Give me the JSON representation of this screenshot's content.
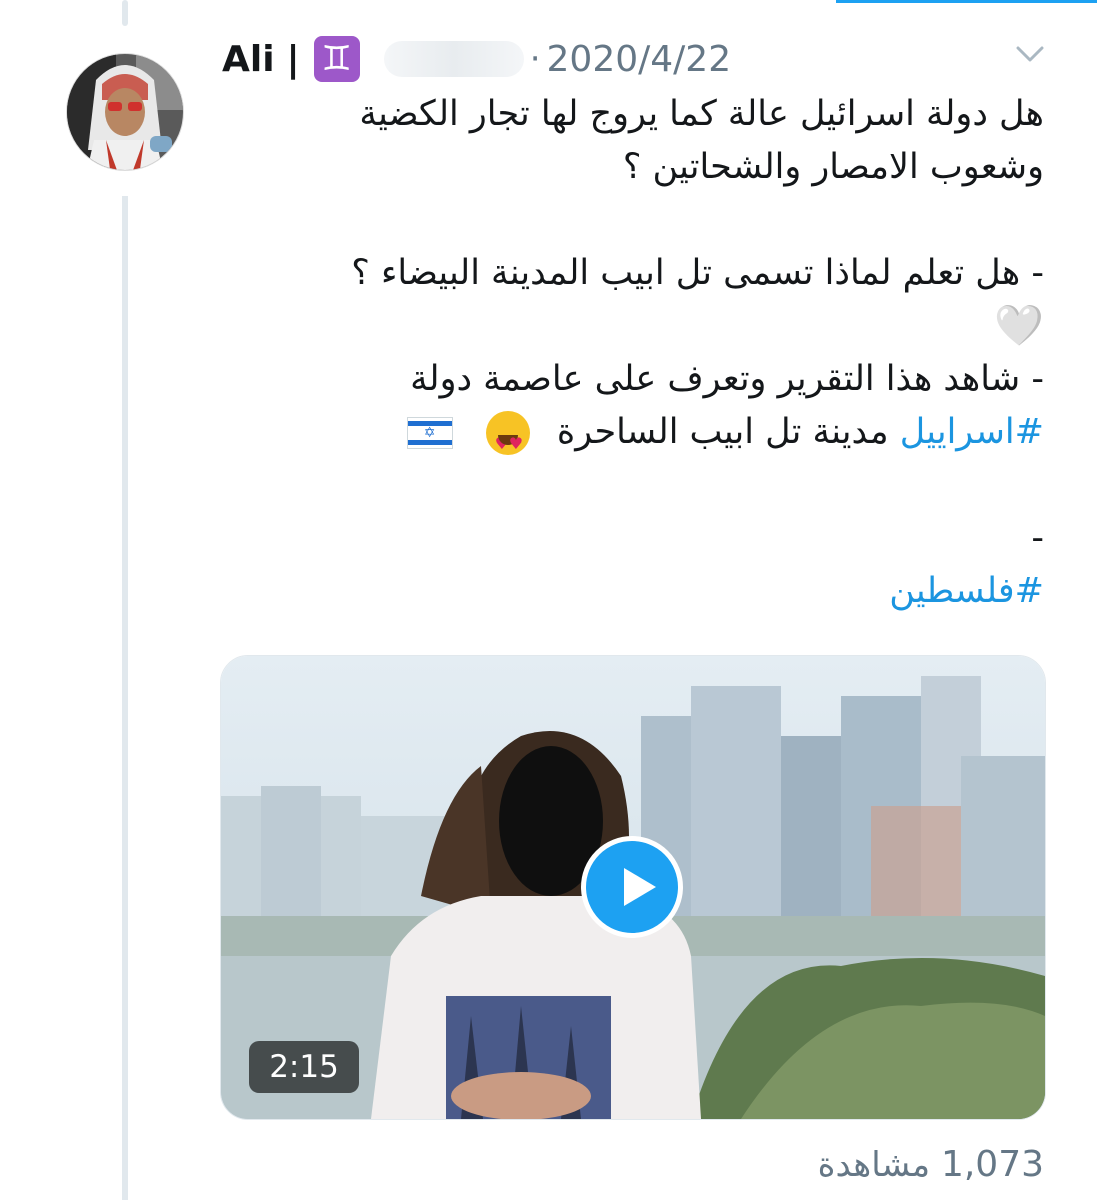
{
  "tweet": {
    "author_name": "Ali",
    "separator": "|",
    "zodiac_emoji": "♊",
    "date_separator": "·",
    "date": "2020/4/22",
    "lines": [
      "هل دولة اسرائيل عالة كما يروج لها تجار الكضية",
      "وشعوب الامصار والشحاتين ؟",
      "- هل تعلم لماذا تسمى تل ابيب المدينة البيضاء ؟",
      "🤍",
      "- شاهد هذا التقرير وتعرف على عاصمة دولة"
    ],
    "hashtag1": "#اسراييل",
    "line6_text": "مدينة تل ابيب الساحرة",
    "emoji_face": "😍",
    "flag_emoji": "🇮🇱",
    "dash": "-",
    "hashtag2": "#فلسطين"
  },
  "video": {
    "duration": "2:15"
  },
  "views": {
    "count": "1,073",
    "label": "مشاهدة"
  },
  "icons": [
    "avatar",
    "zodiac-gemini-icon",
    "chevron-down-icon",
    "white-heart-icon",
    "heart-eyes-emoji-icon",
    "israel-flag-icon",
    "play-icon"
  ],
  "colors": {
    "link": "#1b95e0",
    "accent": "#1da1f2",
    "secondary_text": "#657786",
    "zodiac_bg": "#9d58c9"
  }
}
